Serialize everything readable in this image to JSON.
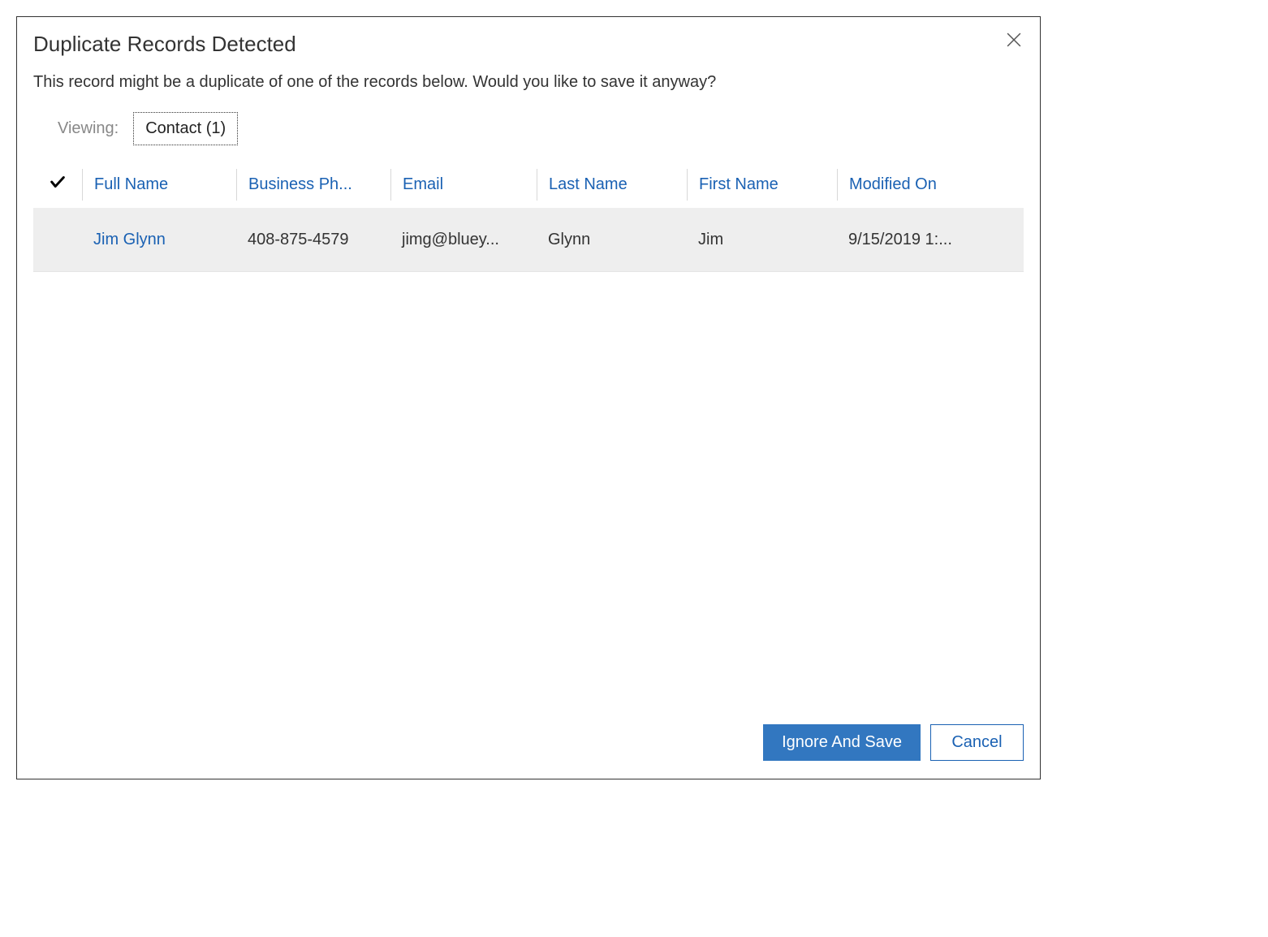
{
  "dialog": {
    "title": "Duplicate Records Detected",
    "subtitle": "This record might be a duplicate of one of the records below. Would you like to save it anyway?"
  },
  "viewing": {
    "label": "Viewing:",
    "tab": "Contact (1)"
  },
  "table": {
    "headers": {
      "full_name": "Full Name",
      "business_phone": "Business Ph...",
      "email": "Email",
      "last_name": "Last Name",
      "first_name": "First Name",
      "modified_on": "Modified On"
    },
    "rows": [
      {
        "full_name": "Jim Glynn",
        "business_phone": "408-875-4579",
        "email": "jimg@bluey...",
        "last_name": "Glynn",
        "first_name": "Jim",
        "modified_on": "9/15/2019 1:..."
      }
    ]
  },
  "footer": {
    "ignore_save": "Ignore And Save",
    "cancel": "Cancel"
  }
}
